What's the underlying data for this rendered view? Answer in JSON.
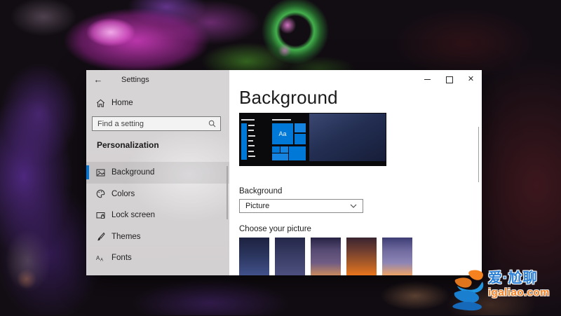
{
  "window": {
    "title": "Settings",
    "back_icon": "←",
    "close_icon": "✕"
  },
  "sidebar": {
    "home_label": "Home",
    "search_placeholder": "Find a setting",
    "section_heading": "Personalization",
    "items": [
      {
        "icon": "background",
        "label": "Background",
        "selected": true
      },
      {
        "icon": "colors",
        "label": "Colors",
        "selected": false
      },
      {
        "icon": "lock-screen",
        "label": "Lock screen",
        "selected": false
      },
      {
        "icon": "themes",
        "label": "Themes",
        "selected": false
      },
      {
        "icon": "fonts",
        "label": "Fonts",
        "selected": false
      }
    ]
  },
  "main": {
    "heading": "Background",
    "preview_tile_text": "Aa",
    "background_label": "Background",
    "dropdown_value": "Picture",
    "choose_label": "Choose your picture",
    "thumbnails": [
      {
        "name": "picture-1",
        "gradient": [
          "#1c2140",
          "#2c3760",
          "#41518a"
        ]
      },
      {
        "name": "picture-2",
        "gradient": [
          "#242748",
          "#3a3d66",
          "#4d4f7e"
        ]
      },
      {
        "name": "picture-3",
        "gradient": [
          "#272345",
          "#564a72",
          "#6f5c84",
          "#c98a5e"
        ]
      },
      {
        "name": "picture-4",
        "gradient": [
          "#3a2430",
          "#6e3d30",
          "#a85a28",
          "#e8751e"
        ]
      },
      {
        "name": "picture-5",
        "gradient": [
          "#3d3d74",
          "#6f6a9e",
          "#8d85b5",
          "#eda366"
        ]
      }
    ]
  },
  "watermark": {
    "title": "爱·尬聊",
    "url": "igaliao.com"
  },
  "colors": {
    "accent": "#0078d7",
    "watermark_blue": "#2b7fd4",
    "watermark_orange": "#f5821f",
    "sidebar_gray": "#d7d4d5"
  }
}
